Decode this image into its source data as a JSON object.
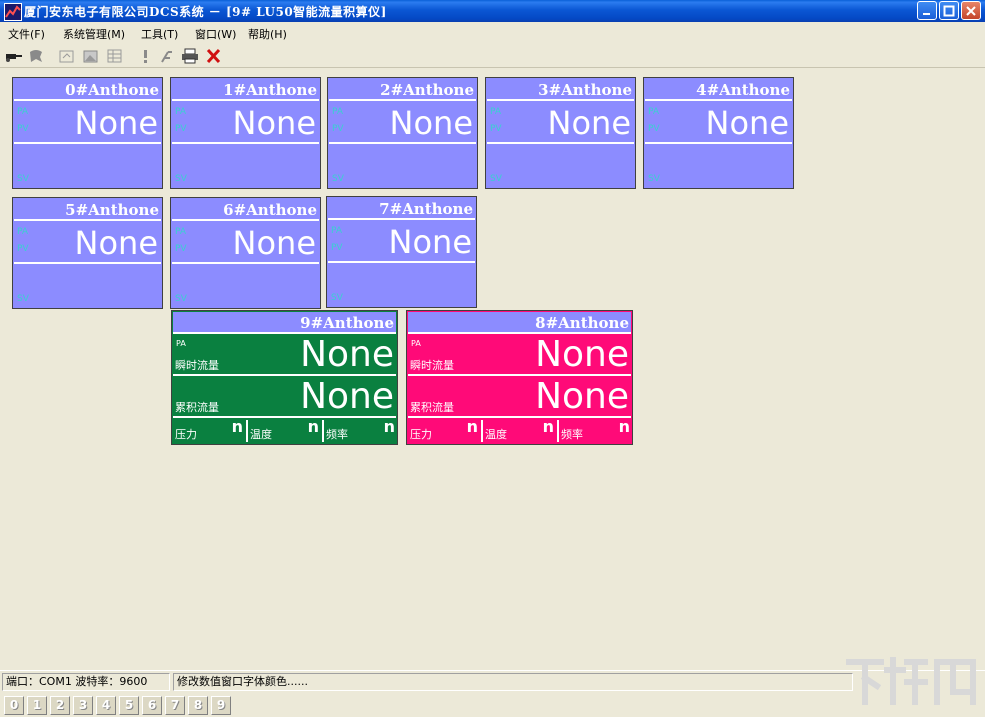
{
  "window": {
    "title": "厦门安东电子有限公司DCS系统 － [9# LU50智能流量积算仪]"
  },
  "menu": [
    {
      "label": "文件(F)"
    },
    {
      "label": "系统管理(M)"
    },
    {
      "label": "工具(T)"
    },
    {
      "label": "窗口(W)"
    },
    {
      "label": "帮助(H)"
    }
  ],
  "toolbar": {
    "icons": [
      "connect-icon",
      "tree-icon",
      "settings-icon",
      "picture-icon",
      "grid-icon",
      "alert-icon",
      "query-icon",
      "print-icon",
      "close-x-icon"
    ]
  },
  "panels": [
    {
      "title": "0#Anthone",
      "pa": "PA",
      "pv": "PV",
      "value": "None",
      "sv": "SV"
    },
    {
      "title": "1#Anthone",
      "pa": "PA",
      "pv": "PV",
      "value": "None",
      "sv": "SV"
    },
    {
      "title": "2#Anthone",
      "pa": "PA",
      "pv": "PV",
      "value": "None",
      "sv": "SV"
    },
    {
      "title": "3#Anthone",
      "pa": "PA",
      "pv": "PV",
      "value": "None",
      "sv": "SV"
    },
    {
      "title": "4#Anthone",
      "pa": "PA",
      "pv": "PV",
      "value": "None",
      "sv": "SV"
    },
    {
      "title": "5#Anthone",
      "pa": "PA",
      "pv": "PV",
      "value": "None",
      "sv": "SV"
    },
    {
      "title": "6#Anthone",
      "pa": "PA",
      "pv": "PV",
      "value": "None",
      "sv": "SV"
    },
    {
      "title": "7#Anthone",
      "pa": "PA",
      "pv": "PV",
      "value": "None",
      "sv": "SV"
    }
  ],
  "flow_panels": [
    {
      "title": "9#Anthone",
      "color": "#0a8040",
      "pa": "PA",
      "instant_label": "瞬时流量",
      "instant_value": "None",
      "total_label": "累积流量",
      "total_value": "None",
      "cells": [
        {
          "label": "压力",
          "value": "n"
        },
        {
          "label": "温度",
          "value": "n"
        },
        {
          "label": "频率",
          "value": "n"
        }
      ]
    },
    {
      "title": "8#Anthone",
      "color": "#ff0a78",
      "pa": "PA",
      "instant_label": "瞬时流量",
      "instant_value": "None",
      "total_label": "累积流量",
      "total_value": "None",
      "cells": [
        {
          "label": "压力",
          "value": "n"
        },
        {
          "label": "温度",
          "value": "n"
        },
        {
          "label": "频率",
          "value": "n"
        }
      ]
    }
  ],
  "status": {
    "port": "端口：COM1  波特率：9600",
    "message": "修改数值窗口字体颜色......"
  },
  "tabs": [
    "0",
    "1",
    "2",
    "3",
    "4",
    "5",
    "6",
    "7",
    "8",
    "9"
  ],
  "watermark": "下载吧"
}
